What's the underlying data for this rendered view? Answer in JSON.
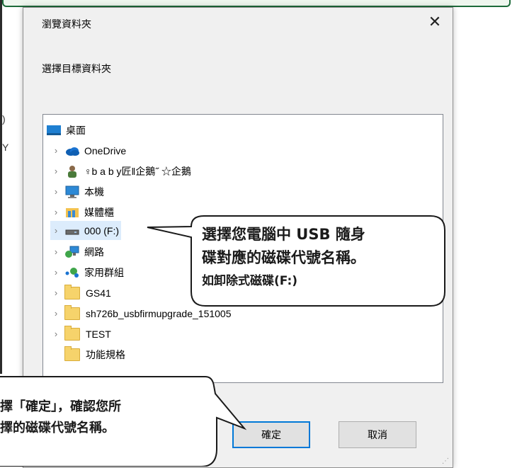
{
  "dialog": {
    "title": "瀏覽資料夾",
    "instruction": "選擇目標資料夾",
    "close_glyph": "✕",
    "ok_label": "確定",
    "cancel_label": "取消"
  },
  "tree": {
    "items": [
      {
        "label": "桌面",
        "icon": "desktop-icon"
      },
      {
        "label": "OneDrive",
        "icon": "cloud-icon"
      },
      {
        "label": "♀b a b y匠‖企鵝˝ ☆企鵝",
        "icon": "user-icon"
      },
      {
        "label": "本機",
        "icon": "computer-icon"
      },
      {
        "label": "媒體櫃",
        "icon": "library-icon"
      },
      {
        "label": "000 (F:)",
        "icon": "drive-icon"
      },
      {
        "label": "網路",
        "icon": "network-icon"
      },
      {
        "label": "家用群組",
        "icon": "homegroup-icon"
      },
      {
        "label": "GS41",
        "icon": "folder-icon"
      },
      {
        "label": "sh726b_usbfirmupgrade_151005",
        "icon": "folder-icon"
      },
      {
        "label": "TEST",
        "icon": "folder-icon"
      },
      {
        "label": "功能規格",
        "icon": "folder-icon"
      }
    ]
  },
  "callouts": {
    "drive": {
      "line1": "選擇您電腦中 USB 隨身",
      "line2": "碟對應的磁碟代號名稱。",
      "line3": "如卸除式磁碟(F:)"
    },
    "confirm": {
      "line1": "擇「確定」，確認您所",
      "line2": "擇的磁碟代號名稱。"
    }
  },
  "background_fragments": {
    "frag1": ")",
    "frag2": "Y"
  },
  "colors": {
    "accent_blue": "#0078d7",
    "selection": "#dcecfc",
    "folder_yellow": "#f6d36b",
    "frame_green": "#1d6b3a"
  }
}
